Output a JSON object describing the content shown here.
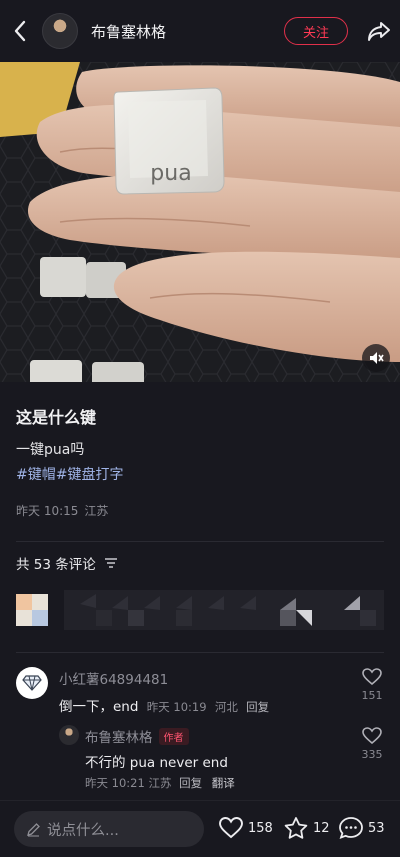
{
  "header": {
    "author_name": "布鲁塞林格",
    "follow_label": "关注"
  },
  "photo": {
    "keycap_text": "pua"
  },
  "post": {
    "title": "这是什么键",
    "description": "一键pua吗",
    "tags": [
      "#键帽",
      "#键盘打字"
    ],
    "time": "昨天 10:15",
    "location": "江苏"
  },
  "comments_header": {
    "count_text": "共 53 条评论"
  },
  "comments": [
    {
      "user": "小红薯64894481",
      "text": "倒一下，end",
      "time": "昨天 10:19",
      "location": "河北",
      "reply_label": "回复",
      "likes": "151"
    },
    {
      "user": "布鲁塞林格",
      "badge": "作者",
      "text": "不行的 pua never end",
      "time": "昨天 10:21",
      "location": "江苏",
      "reply_label": "回复",
      "translate_label": "翻译",
      "likes": "335"
    }
  ],
  "bottom_bar": {
    "input_placeholder": "说点什么...",
    "likes": "158",
    "collects": "12",
    "comments": "53"
  },
  "colors": {
    "background": "#18181f",
    "accent": "#ff3a55",
    "tag": "#9fb3e6"
  }
}
